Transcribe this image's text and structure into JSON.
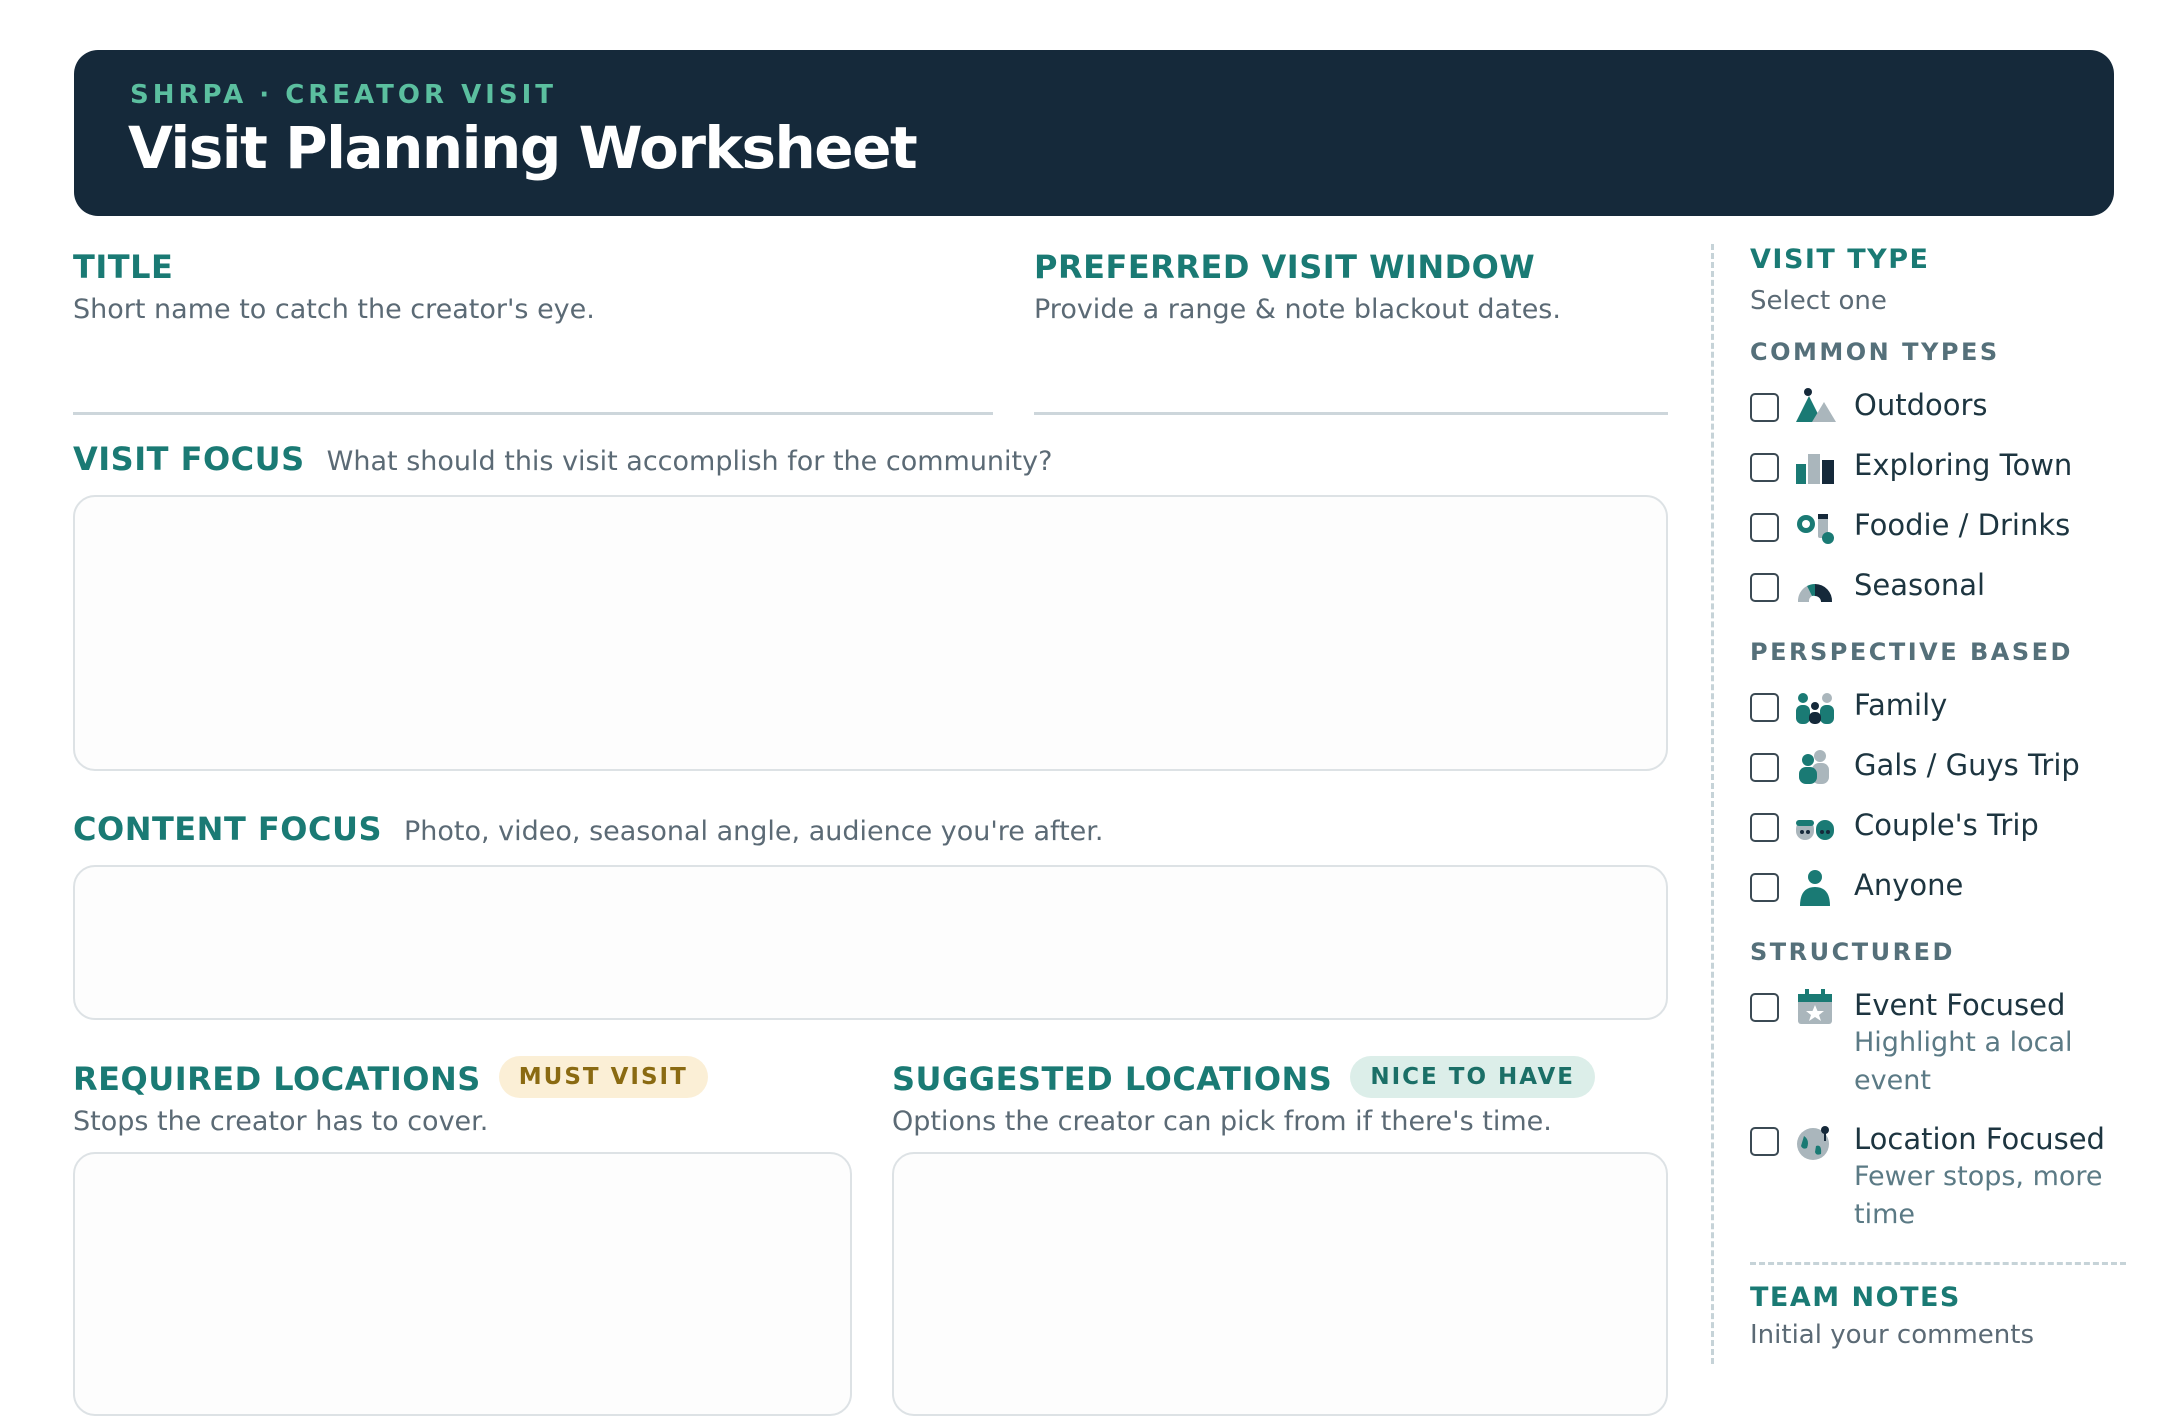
{
  "header": {
    "brand": "SHRPA",
    "separator": "·",
    "eyebrow": "CREATOR VISIT",
    "title": "Visit Planning Worksheet"
  },
  "form": {
    "title_field": {
      "label": "TITLE",
      "hint": "Short name to catch the creator's eye."
    },
    "visit_window": {
      "label": "PREFERRED VISIT WINDOW",
      "hint": "Provide a range & note blackout dates."
    },
    "visit_focus": {
      "label": "VISIT FOCUS",
      "hint": "What should this visit accomplish for the community?"
    },
    "content_focus": {
      "label": "CONTENT FOCUS",
      "hint": "Photo, video, seasonal angle, audience you're after."
    },
    "required_locations": {
      "label": "REQUIRED LOCATIONS",
      "badge": "MUST VISIT",
      "hint": "Stops the creator has to cover."
    },
    "suggested_locations": {
      "label": "SUGGESTED LOCATIONS",
      "badge": "NICE TO HAVE",
      "hint": "Options the creator can pick from if there's time."
    }
  },
  "sidebar": {
    "visit_type": {
      "label": "VISIT TYPE",
      "hint": "Select one"
    },
    "groups": [
      {
        "name": "COMMON TYPES",
        "options": [
          {
            "label": "Outdoors",
            "icon": "mountain-icon",
            "checked": false
          },
          {
            "label": "Exploring Town",
            "icon": "buildings-icon",
            "checked": false
          },
          {
            "label": "Foodie / Drinks",
            "icon": "food-drink-icon",
            "checked": false
          },
          {
            "label": "Seasonal",
            "icon": "season-wheel-icon",
            "checked": false
          }
        ]
      },
      {
        "name": "PERSPECTIVE BASED",
        "options": [
          {
            "label": "Family",
            "icon": "family-icon",
            "checked": false
          },
          {
            "label": "Gals / Guys Trip",
            "icon": "friends-icon",
            "checked": false
          },
          {
            "label": "Couple's Trip",
            "icon": "couple-icon",
            "checked": false
          },
          {
            "label": "Anyone",
            "icon": "person-icon",
            "checked": false
          }
        ]
      },
      {
        "name": "STRUCTURED",
        "options": [
          {
            "label": "Event Focused",
            "description": "Highlight a local event",
            "icon": "calendar-star-icon",
            "checked": false
          },
          {
            "label": "Location Focused",
            "description": "Fewer stops, more time",
            "icon": "globe-pin-icon",
            "checked": false
          }
        ]
      }
    ],
    "team_notes": {
      "label": "TEAM NOTES",
      "hint": "Initial your comments"
    }
  },
  "colors": {
    "header_bg": "#15293a",
    "accent": "#1a7a74",
    "eyebrow": "#5bbf9f"
  }
}
